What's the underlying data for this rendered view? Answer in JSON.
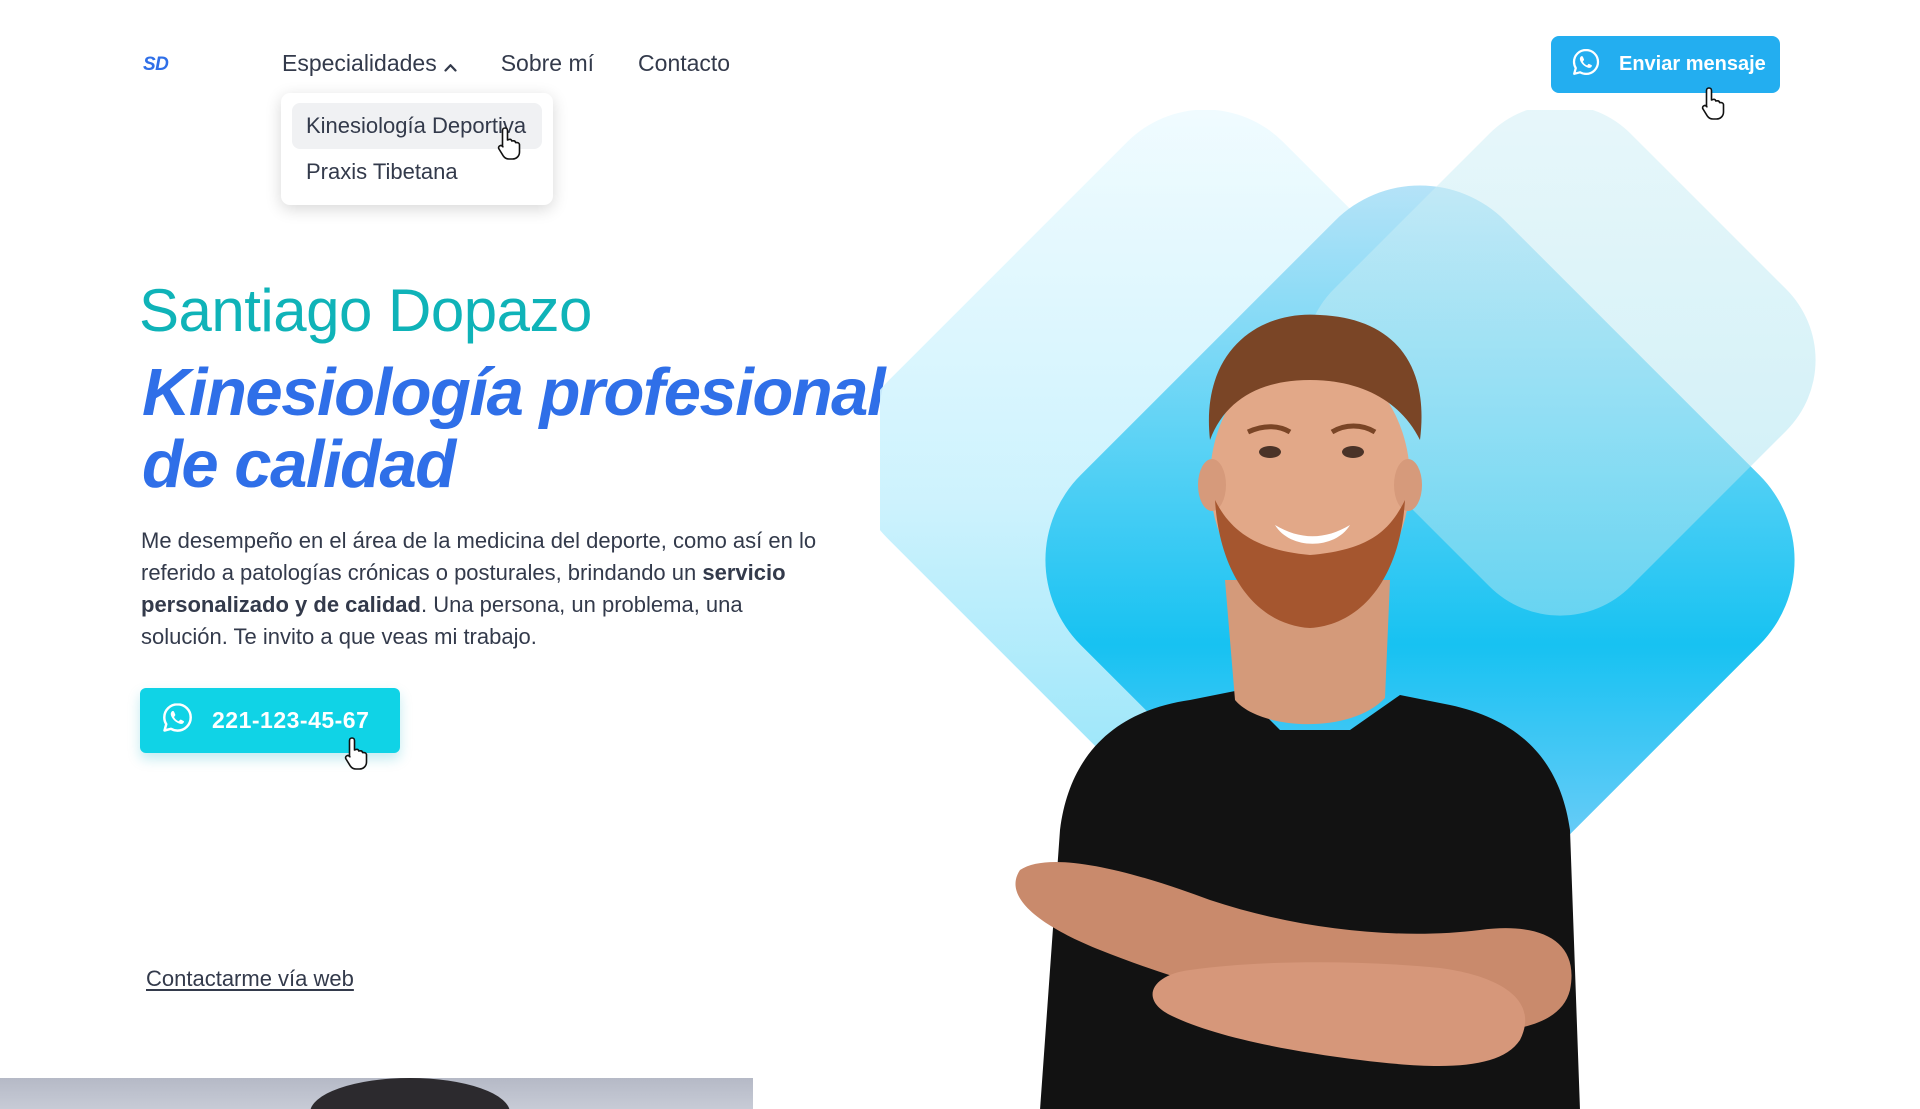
{
  "header": {
    "logo": "SD",
    "nav": [
      {
        "label": "Especialidades"
      },
      {
        "label": "Sobre mí"
      },
      {
        "label": "Contacto"
      }
    ],
    "dropdown": [
      {
        "label": "Kinesiología Deportiva"
      },
      {
        "label": "Praxis Tibetana"
      }
    ],
    "cta_label": "Enviar mensaje"
  },
  "hero": {
    "name": "Santiago Dopazo",
    "tagline_line1": "Kinesiología profesional",
    "tagline_line2": "de calidad",
    "desc_part1": "Me desempeño en el área de la medicina del deporte, como así en lo referido a patologías crónicas o posturales, brindando un ",
    "desc_bold": "servicio personalizado y de calidad",
    "desc_part2": ". Una persona, un problema, una solución. Te invito a que veas mi trabajo.",
    "phone": "221-123-45-67",
    "web_link": "Contactarme vía web"
  },
  "icons": {
    "whatsapp": "whatsapp-icon",
    "chevron": "chevron-up-icon",
    "cursor": "hand-pointer-icon"
  },
  "colors": {
    "brand_blue": "#2f6fe8",
    "teal": "#0fb3b8",
    "header_button": "#23aef0",
    "phone_button": "#10d3e6",
    "text": "#333a4b"
  }
}
